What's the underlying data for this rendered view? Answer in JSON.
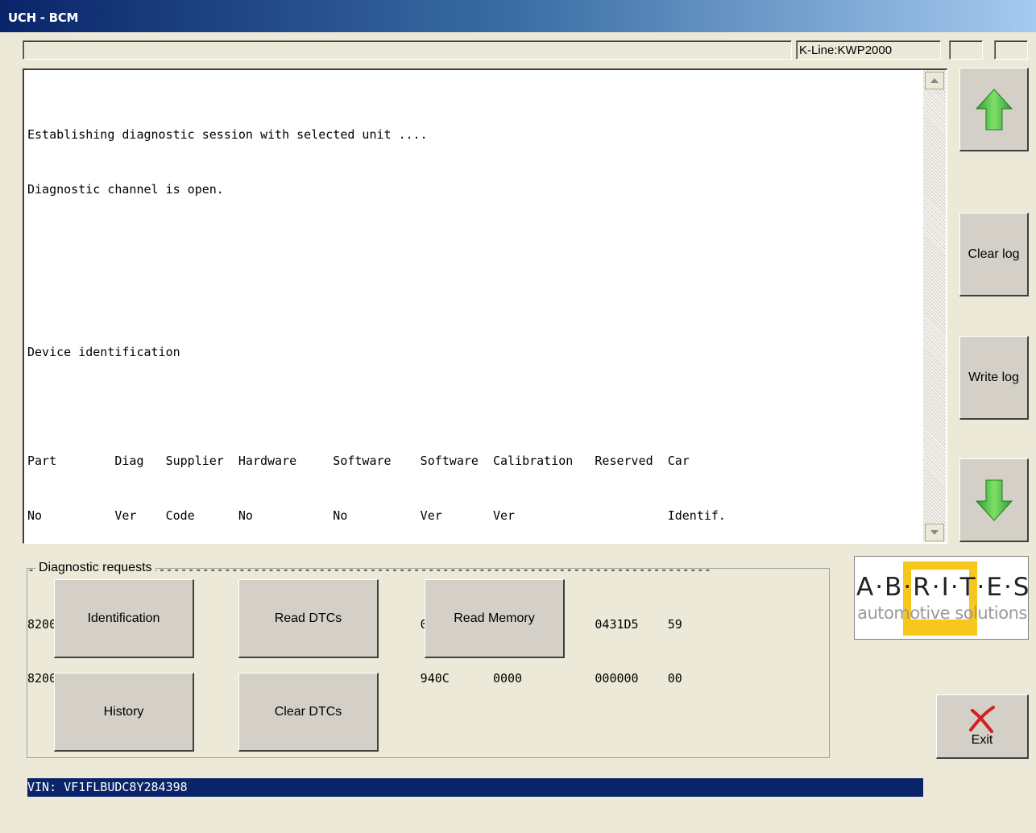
{
  "window": {
    "title": "UCH - BCM"
  },
  "status": {
    "message": "",
    "protocol": "K-Line:KWP2000",
    "box1": "",
    "box2": ""
  },
  "log": {
    "lines": [
      "Establishing diagnostic session with selected unit ....",
      "Diagnostic channel is open.",
      "",
      "",
      "Device identification",
      "",
      "Part        Diag   Supplier  Hardware     Software    Software  Calibration   Reserved  Car",
      "No          Ver    Code      No           No          Ver       Ver                     Identif.",
      "----------------------------------------------------------------------------------------------",
      "8200814465  0C     021       2812128804   0006        0007      000A          0431D5    59",
      "8200823728  14     037       8200666516   00C4        940C      0000          000000    00",
      "",
      "VIN: VF1FLBUDC8Y284398"
    ],
    "selected_index": 12
  },
  "side_buttons": {
    "up_icon": "green-up-arrow-icon",
    "clear_log": "Clear log",
    "write_log": "Write log",
    "down_icon": "green-down-arrow-icon"
  },
  "diagnostic_requests": {
    "label": "Diagnostic requests",
    "buttons": {
      "identification": "Identification",
      "read_dtcs": "Read DTCs",
      "read_memory": "Read Memory",
      "history": "History",
      "clear_dtcs": "Clear DTCs"
    }
  },
  "logo": {
    "word": "A·B·R·I·T·E·S",
    "tagline": "automotive solutions",
    "accent": "#f7c71c"
  },
  "exit": {
    "label": "Exit",
    "icon": "red-x-icon"
  }
}
